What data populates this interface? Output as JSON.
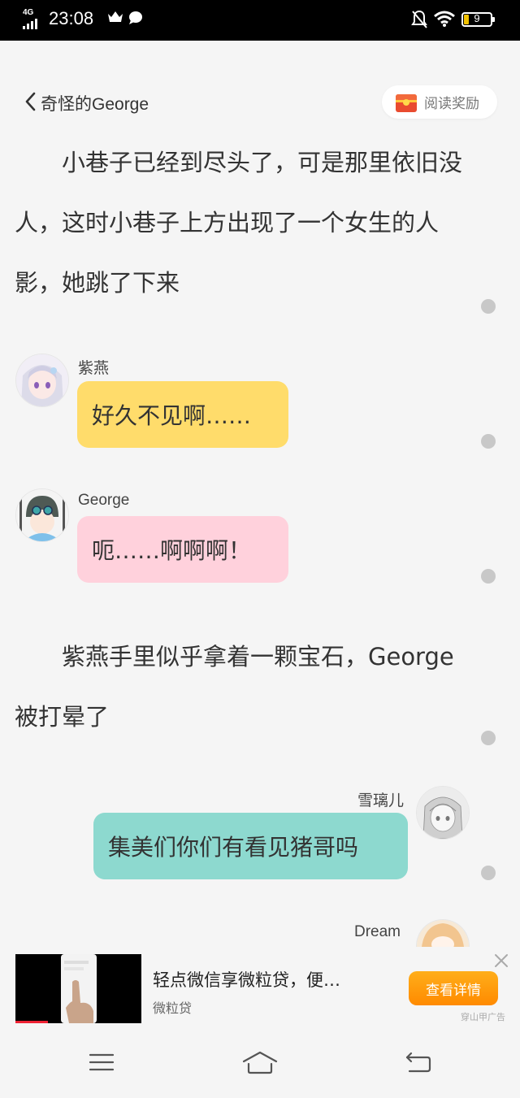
{
  "status_bar": {
    "network": "4G",
    "time": "23:08",
    "battery_level": "9",
    "icons": [
      "crown-icon",
      "chat-bubble-icon",
      "notifications-off-icon",
      "wifi-icon",
      "battery-icon"
    ]
  },
  "header": {
    "back_title": "奇怪的George",
    "reward_label": "阅读奖励"
  },
  "story": {
    "narration_1": "　　小巷子已经到尽头了，可是那里依旧没人，这时小巷子上方出现了一个女生的人影，她跳了下来",
    "narration_2": "　　紫燕手里似乎拿着一颗宝石，George被打晕了",
    "messages": [
      {
        "speaker": "紫燕",
        "text": "好久不见啊……",
        "side": "left",
        "color": "#ffdc6b"
      },
      {
        "speaker": "George",
        "text": "呃……啊啊啊！",
        "side": "left",
        "color": "#ffd1dc"
      },
      {
        "speaker": "雪璃儿",
        "text": "集美们你们有看见猪哥吗",
        "side": "right",
        "color": "#8dd9cf"
      },
      {
        "speaker": "Dream",
        "text": "",
        "side": "right"
      }
    ]
  },
  "ad": {
    "title": "轻点微信享微粒贷，便…",
    "source": "微粒贷",
    "cta_label": "查看详情",
    "ad_tag": "穿山甲广告"
  },
  "colors": {
    "background": "#f5f5f5",
    "accent_orange": "#ff8a00",
    "dot": "#c8c8c8"
  }
}
